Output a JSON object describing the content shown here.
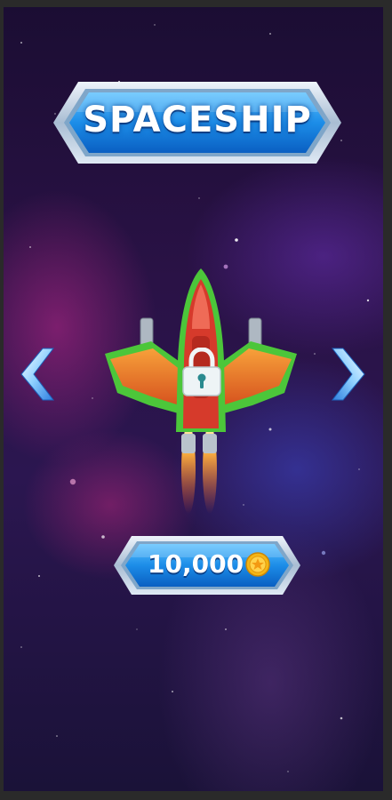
{
  "screen": {
    "title": "SPACESHIP",
    "price": "10,000"
  },
  "icons": {
    "prev": "chevron-left-icon",
    "next": "chevron-right-icon",
    "lock": "padlock-icon",
    "coin": "gold-coin-icon"
  },
  "colors": {
    "banner_blue": "#1e8be6",
    "banner_frame": "#c8d8ea",
    "arrow_blue": "#5fb0ff",
    "ship_red": "#d63a2b",
    "ship_green": "#4cc63a",
    "ship_orange": "#ef7a2a",
    "coin_gold": "#f5b614"
  }
}
